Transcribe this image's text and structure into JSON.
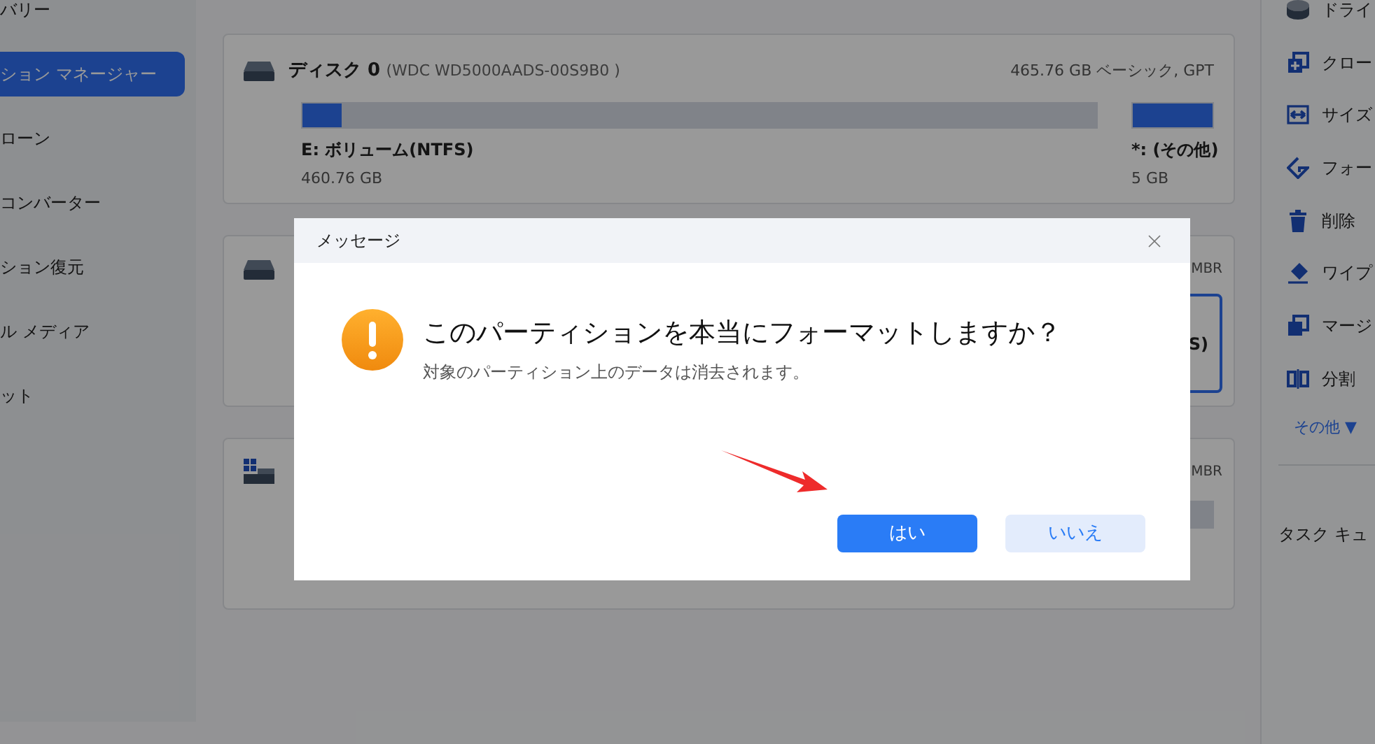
{
  "sidebar": {
    "items": [
      {
        "label": "バリー",
        "selected": false
      },
      {
        "label": "ション マネージャー",
        "selected": true
      },
      {
        "label": "ローン",
        "selected": false
      },
      {
        "label": "コンバーター",
        "selected": false
      },
      {
        "label": "ション復元",
        "selected": false
      },
      {
        "label": "ル メディア",
        "selected": false
      },
      {
        "label": "ット",
        "selected": false
      }
    ]
  },
  "disks": [
    {
      "kind": "disk",
      "name": "ディスク",
      "number": "0",
      "model": "(WDC WD5000AADS-00S9B0 )",
      "info": "465.76 GB ベーシック, GPT",
      "partitions": [
        {
          "label": "E: ボリューム(NTFS)",
          "size": "460.76 GB",
          "level": 0.05
        },
        {
          "label": "*: (その他)",
          "size": "5 GB",
          "level": 1
        }
      ]
    },
    {
      "kind": "disk",
      "info": "MBR",
      "partitions": [
        {
          "label": "S)",
          "selected": true
        }
      ]
    },
    {
      "kind": "system",
      "info": "MBR"
    }
  ],
  "actions": [
    {
      "kind": "drive",
      "label": "ドライ"
    },
    {
      "kind": "clone",
      "label": "クロー"
    },
    {
      "kind": "resize",
      "label": "サイズ"
    },
    {
      "kind": "format",
      "label": "フォー"
    },
    {
      "kind": "delete",
      "label": "削除"
    },
    {
      "kind": "wipe",
      "label": "ワイプ"
    },
    {
      "kind": "merge",
      "label": "マージ"
    },
    {
      "kind": "split",
      "label": "分割"
    }
  ],
  "more_link": "その他 ▼",
  "task_queue": "タスク キュ",
  "dialog": {
    "title": "メッセージ",
    "heading": "このパーティションを本当にフォーマットしますか？",
    "message": "対象のパーティション上のデータは消去されます。",
    "buttons": [
      {
        "label": "はい",
        "kind": "primary"
      },
      {
        "label": "いいえ",
        "kind": "secondary"
      }
    ]
  }
}
